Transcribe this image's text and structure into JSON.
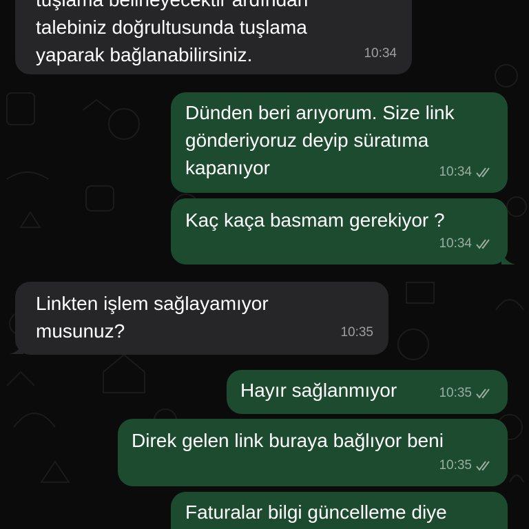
{
  "chat": {
    "messages": [
      {
        "direction": "incoming",
        "lines": [
          "tuşlama belirleyecektir ardından",
          "talebiniz doğrultusunda tuşlama",
          "yaparak bağlanabilirsiniz."
        ],
        "time": "10:34"
      },
      {
        "direction": "outgoing",
        "lines": [
          "Dünden beri arıyorum. Size link",
          "gönderiyoruz deyip süratıma",
          "kapanıyor"
        ],
        "time": "10:34",
        "status": "read"
      },
      {
        "direction": "outgoing",
        "lines": [
          "Kaç kaça basmam gerekiyor ?"
        ],
        "time": "10:34",
        "status": "read"
      },
      {
        "direction": "incoming",
        "lines": [
          "Linkten işlem sağlayamıyor",
          "musunuz?"
        ],
        "time": "10:35"
      },
      {
        "direction": "outgoing",
        "lines": [
          "Hayır sağlanmıyor"
        ],
        "time": "10:35",
        "status": "read"
      },
      {
        "direction": "outgoing",
        "lines": [
          "Direk gelen link buraya bağlıyor beni"
        ],
        "time": "10:35",
        "status": "read"
      },
      {
        "direction": "outgoing",
        "lines": [
          "Faturalar bilgi güncelleme diye"
        ],
        "time": "",
        "status": ""
      }
    ]
  },
  "icons": {
    "read_receipt": "double-check-icon"
  },
  "colors": {
    "background": "#0b0b0b",
    "incoming_bubble": "#262628",
    "outgoing_bubble": "#1d4b2f",
    "text": "#ffffff"
  }
}
